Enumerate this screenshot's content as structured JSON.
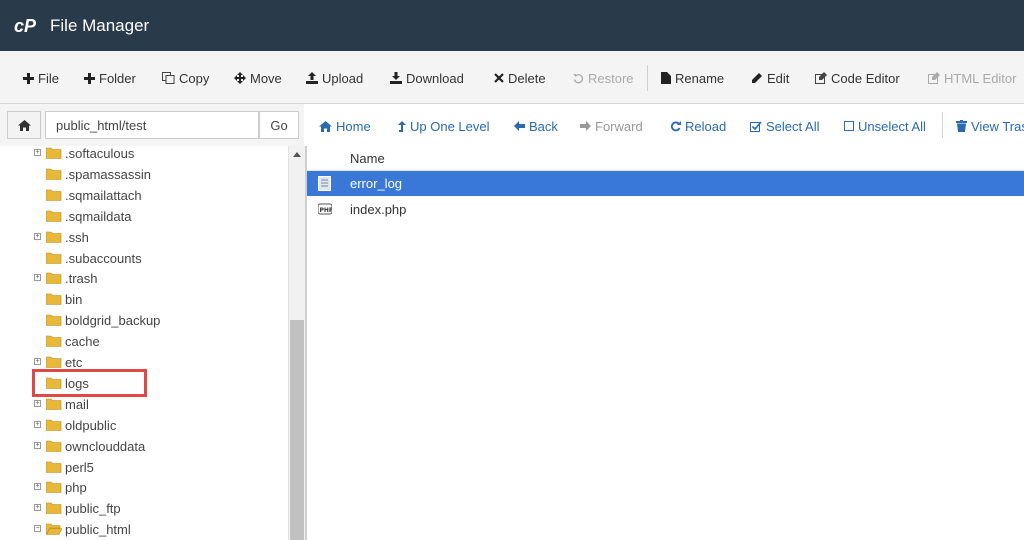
{
  "app": {
    "title": "File Manager",
    "logo_icon": "cpanel-logo"
  },
  "toolbar": {
    "items": [
      {
        "label": "File",
        "icon": "plus-icon",
        "enabled": true
      },
      {
        "label": "Folder",
        "icon": "plus-icon",
        "enabled": true
      },
      {
        "label": "Copy",
        "icon": "copy-icon",
        "enabled": true
      },
      {
        "label": "Move",
        "icon": "move-icon",
        "enabled": true
      },
      {
        "label": "Upload",
        "icon": "upload-icon",
        "enabled": true
      },
      {
        "label": "Download",
        "icon": "download-icon",
        "enabled": true
      },
      {
        "label": "Delete",
        "icon": "close-icon",
        "enabled": true
      },
      {
        "label": "Restore",
        "icon": "restore-icon",
        "enabled": false
      },
      {
        "label": "Rename",
        "icon": "file-icon",
        "enabled": true
      },
      {
        "label": "Edit",
        "icon": "pencil-icon",
        "enabled": true
      },
      {
        "label": "Code Editor",
        "icon": "edit-square-icon",
        "enabled": true
      },
      {
        "label": "HTML Editor",
        "icon": "edit-square-icon",
        "enabled": false
      }
    ]
  },
  "path": {
    "value": "public_html/test",
    "go_label": "Go"
  },
  "nav": {
    "items": [
      {
        "label": "Home",
        "icon": "home-icon",
        "enabled": true
      },
      {
        "label": "Up One Level",
        "icon": "level-up-icon",
        "enabled": true
      },
      {
        "label": "Back",
        "icon": "arrow-left-icon",
        "enabled": true
      },
      {
        "label": "Forward",
        "icon": "arrow-right-icon",
        "enabled": false
      },
      {
        "label": "Reload",
        "icon": "reload-icon",
        "enabled": true
      },
      {
        "label": "Select All",
        "icon": "checkbox-checked-icon",
        "enabled": true
      },
      {
        "label": "Unselect All",
        "icon": "checkbox-empty-icon",
        "enabled": true
      },
      {
        "label": "View Tras",
        "icon": "trash-icon",
        "enabled": true
      }
    ]
  },
  "tree": {
    "items": [
      {
        "label": ".softaculous",
        "expandable": true
      },
      {
        "label": ".spamassassin",
        "expandable": false
      },
      {
        "label": ".sqmailattach",
        "expandable": false
      },
      {
        "label": ".sqmaildata",
        "expandable": false
      },
      {
        "label": ".ssh",
        "expandable": true
      },
      {
        "label": ".subaccounts",
        "expandable": false
      },
      {
        "label": ".trash",
        "expandable": true
      },
      {
        "label": "bin",
        "expandable": false
      },
      {
        "label": "boldgrid_backup",
        "expandable": false
      },
      {
        "label": "cache",
        "expandable": false
      },
      {
        "label": "etc",
        "expandable": true
      },
      {
        "label": "logs",
        "expandable": false,
        "highlighted": true
      },
      {
        "label": "mail",
        "expandable": true
      },
      {
        "label": "oldpublic",
        "expandable": true
      },
      {
        "label": "owncloud­data",
        "expandable": true
      },
      {
        "label": "perl5",
        "expandable": false
      },
      {
        "label": "php",
        "expandable": true
      },
      {
        "label": "public_ftp",
        "expandable": true
      },
      {
        "label": "public_html",
        "expandable": true,
        "open": true
      }
    ]
  },
  "files": {
    "column_name": "Name",
    "rows": [
      {
        "name": "error_log",
        "icon": "text-file-icon",
        "selected": true
      },
      {
        "name": "index.php",
        "icon": "php-file-icon",
        "selected": false
      }
    ]
  },
  "colors": {
    "header_bg": "#293a4a",
    "accent": "#2a6ab0",
    "selection": "#3a78d8",
    "highlight_border": "#e04848"
  }
}
